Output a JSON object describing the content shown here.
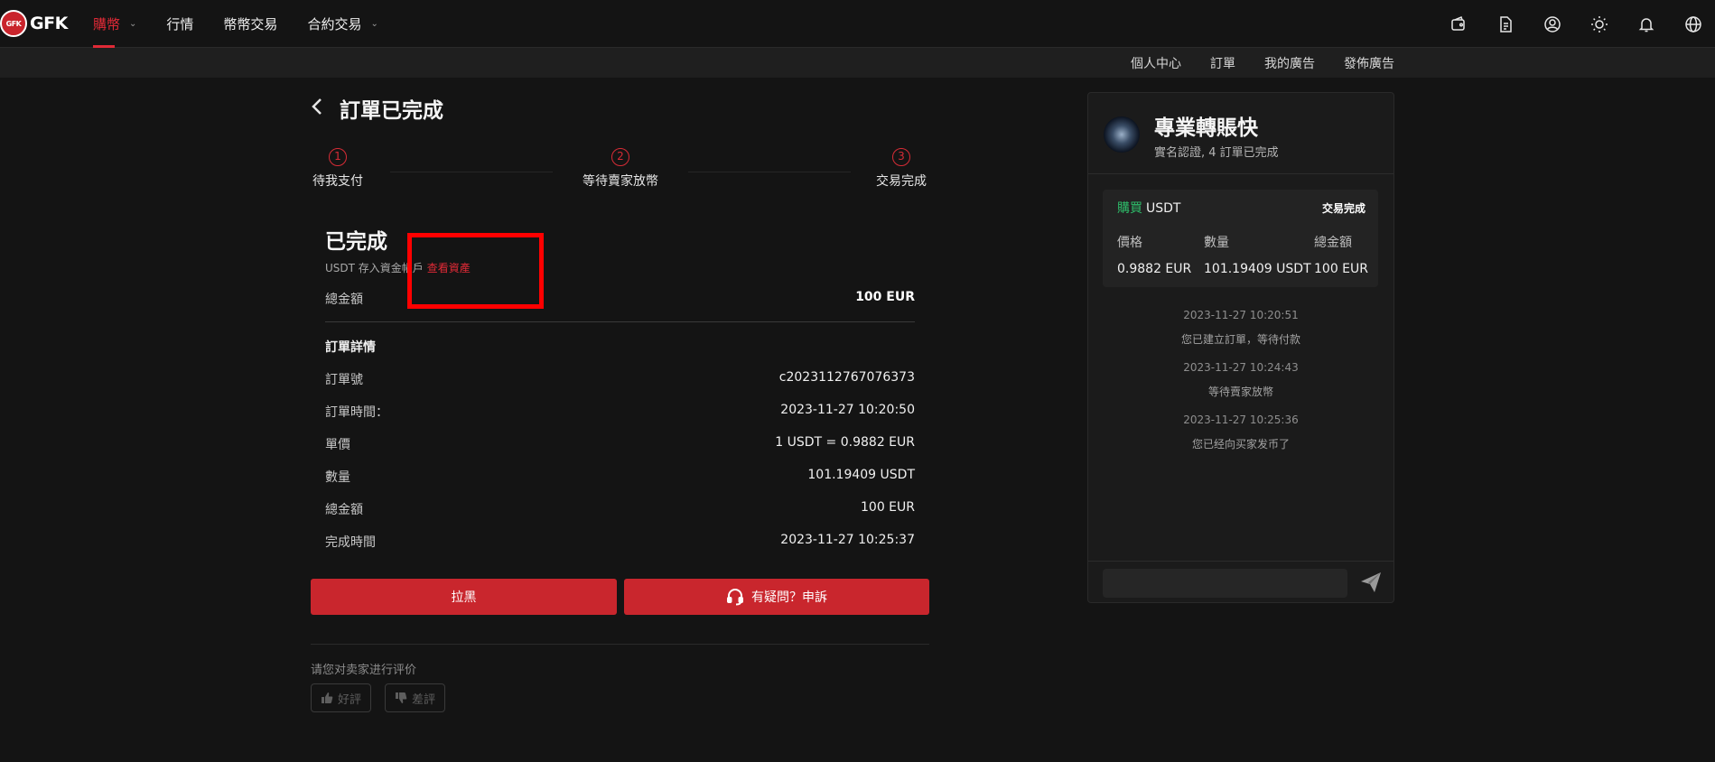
{
  "brand": {
    "logo_text": "GFK",
    "logo_badge": "GFK"
  },
  "nav": {
    "items": [
      {
        "label": "購幣",
        "active": true,
        "has_dropdown": true
      },
      {
        "label": "行情",
        "active": false,
        "has_dropdown": false
      },
      {
        "label": "幣幣交易",
        "active": false,
        "has_dropdown": false
      },
      {
        "label": "合約交易",
        "active": false,
        "has_dropdown": true
      }
    ],
    "icons": [
      "wallet-icon",
      "document-icon",
      "user-icon",
      "theme-sun-icon",
      "bell-icon",
      "globe-icon"
    ]
  },
  "subnav": {
    "items": [
      "個人中心",
      "訂單",
      "我的廣告",
      "發佈廣告"
    ]
  },
  "page": {
    "title": "訂單已完成"
  },
  "steps": [
    {
      "num": "1",
      "label": "待我支付"
    },
    {
      "num": "2",
      "label": "等待賣家放幣"
    },
    {
      "num": "3",
      "label": "交易完成"
    }
  ],
  "status": {
    "title": "已完成",
    "subtitle": "USDT 存入資金帳戶",
    "link": "查看資產",
    "total_label": "總金額",
    "total_value": "100 EUR"
  },
  "details": {
    "title": "訂單詳情",
    "rows": [
      {
        "label": "訂單號",
        "value": "c2023112767076373"
      },
      {
        "label": "訂單時間：",
        "value": "2023-11-27 10:20:50"
      },
      {
        "label": "單價",
        "value": "1 USDT = 0.9882 EUR"
      },
      {
        "label": "數量",
        "value": "101.19409 USDT"
      },
      {
        "label": "總金額",
        "value": "100 EUR"
      },
      {
        "label": "完成時間",
        "value": "2023-11-27 10:25:37"
      }
    ]
  },
  "actions": {
    "block_label": "拉黑",
    "appeal_label": "有疑問？申訴"
  },
  "rating": {
    "prompt": "请您对卖家进行评价",
    "good_label": "好評",
    "bad_label": "差評"
  },
  "merchant": {
    "name": "專業轉賬快",
    "info": "實名認證, 4 訂單已完成"
  },
  "order_card": {
    "side": "購買",
    "coin": "USDT",
    "status": "交易完成",
    "columns": [
      {
        "header": "價格",
        "value": "0.9882 EUR"
      },
      {
        "header": "數量",
        "value": "101.19409 USDT"
      },
      {
        "header": "總金額",
        "value": "100 EUR"
      }
    ]
  },
  "events": [
    {
      "time": "2023-11-27 10:20:51",
      "message": "您已建立訂單，等待付款"
    },
    {
      "time": "2023-11-27 10:24:43",
      "message": "等待賣家放幣"
    },
    {
      "time": "2023-11-27 10:25:36",
      "message": "您已经向买家发币了"
    }
  ],
  "colors": {
    "accent": "#e02a36",
    "buy": "#2ebd6a",
    "button": "#c9262d",
    "annotation": "#ff0000"
  }
}
